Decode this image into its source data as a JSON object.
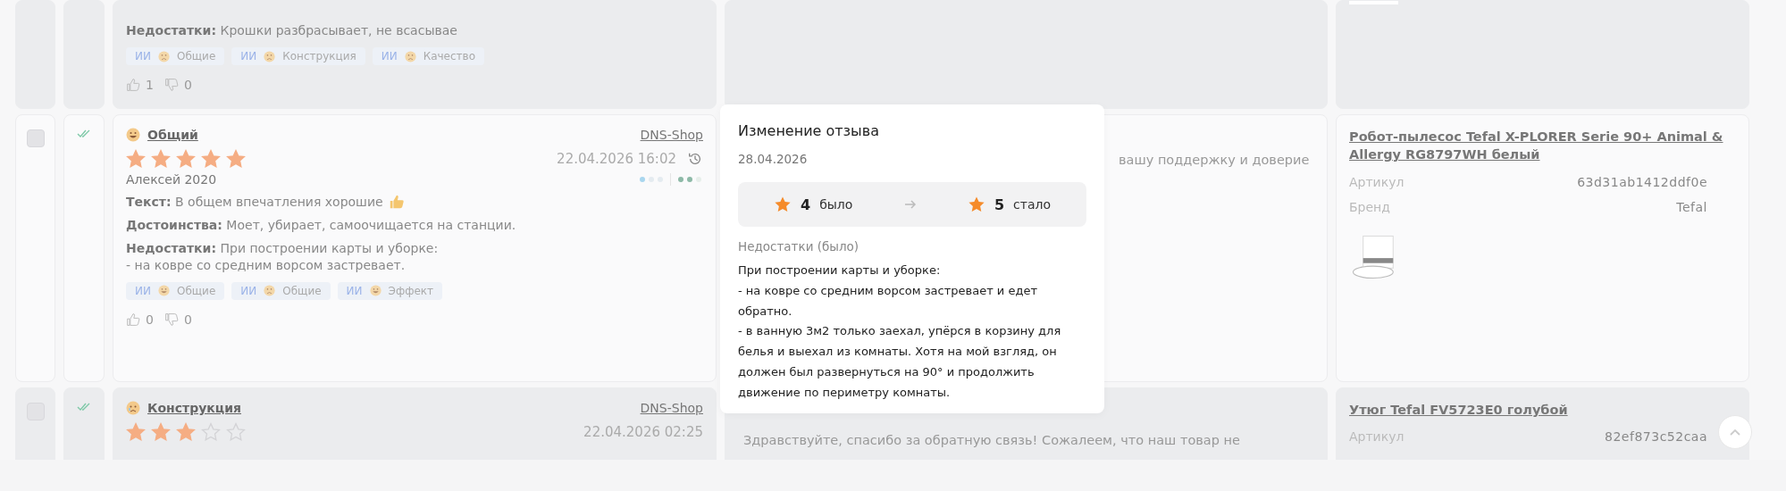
{
  "rows": [
    {
      "highlighted": true,
      "review": {
        "fields": [
          {
            "text": "**Недостатки:** Крошки разбрасывает, не всасывае",
            "thumbs_up": false
          }
        ],
        "tags": [
          {
            "ai": "ИИ",
            "smiling": false,
            "label": "Общие"
          },
          {
            "ai": "ИИ",
            "smiling": false,
            "label": "Конструкция"
          },
          {
            "ai": "ИИ",
            "smiling": false,
            "label": "Качество"
          }
        ],
        "likes": "1",
        "dislikes": "0"
      },
      "answer": {},
      "product": {
        "image": true
      }
    },
    {
      "highlighted": false,
      "checked": false,
      "read": true,
      "review": {
        "smiling": true,
        "topic": "Общий",
        "source": "DNS-Shop",
        "stars": 5,
        "date": "22.04.2026 16:02",
        "history": true,
        "author": "Алексей 2020",
        "dots": [
          {
            "color": "#a9d6ee"
          },
          {
            "color": "#e4ebf0"
          },
          {
            "color": "#e4ebf0"
          },
          {
            "color": "#8db9a7"
          },
          {
            "color": "#8db9a7"
          },
          {
            "color": "#e6eeea"
          }
        ],
        "fields": [
          {
            "text": "**Текст:** В общем впечатления хорошие",
            "thumbs_up": true
          },
          {
            "text": "**Достоинства:** Моет, убирает, самоочищается на станции.",
            "thumbs_up": false
          },
          {
            "text": "**Недостатки:** При построении карты и уборке:\n- на ковре со средним ворсом застревает.",
            "thumbs_up": false
          }
        ],
        "tags": [
          {
            "ai": "ИИ",
            "smiling": true,
            "label": "Общие"
          },
          {
            "ai": "ИИ",
            "smiling": false,
            "label": "Общие"
          },
          {
            "ai": "ИИ",
            "smiling": true,
            "label": "Эффект"
          }
        ],
        "likes": "0",
        "dislikes": "0"
      },
      "answer": {
        "text": "вашу поддержку и доверие"
      },
      "product": {
        "title": "Робот-пылесос Tefal X-PLORER Serie 90+ Animal & Allergy RG8797WH белый",
        "props": [
          {
            "label": "Артикул",
            "value": "63d31ab1412ddf0e"
          },
          {
            "label": "Бренд",
            "value": "Tefal"
          }
        ],
        "image": true
      }
    },
    {
      "highlighted": true,
      "checked": false,
      "read": true,
      "review": {
        "smiling": false,
        "topic": "Конструкция",
        "source": "DNS-Shop",
        "stars": 3,
        "date": "22.04.2026 02:25",
        "history": false
      },
      "answer": {
        "text": "Здравствуйте, спасибо за обратную связь! Сожалеем, что наш товар не"
      },
      "product": {
        "title": "Утюг Tefal FV5723E0 голубой",
        "props": [
          {
            "label": "Артикул",
            "value": "82ef873c52caa"
          }
        ]
      }
    }
  ],
  "popup": {
    "title": "Изменение отзыва",
    "date": "28.04.2026",
    "from": {
      "stars": "4",
      "label": "было"
    },
    "to": {
      "stars": "5",
      "label": "стало"
    },
    "section": "Недостатки (было)",
    "body": "При построении карты и уборке:\n- на ковре со средним ворсом застревает и едет обратно.\n- в ванную 3м2 только заехал, упёрся в корзину для белья и выехал из комнаты. Хотя на мой взгляд, он должен был развернуться на 90° и продолжить движение по периметру комнаты."
  }
}
